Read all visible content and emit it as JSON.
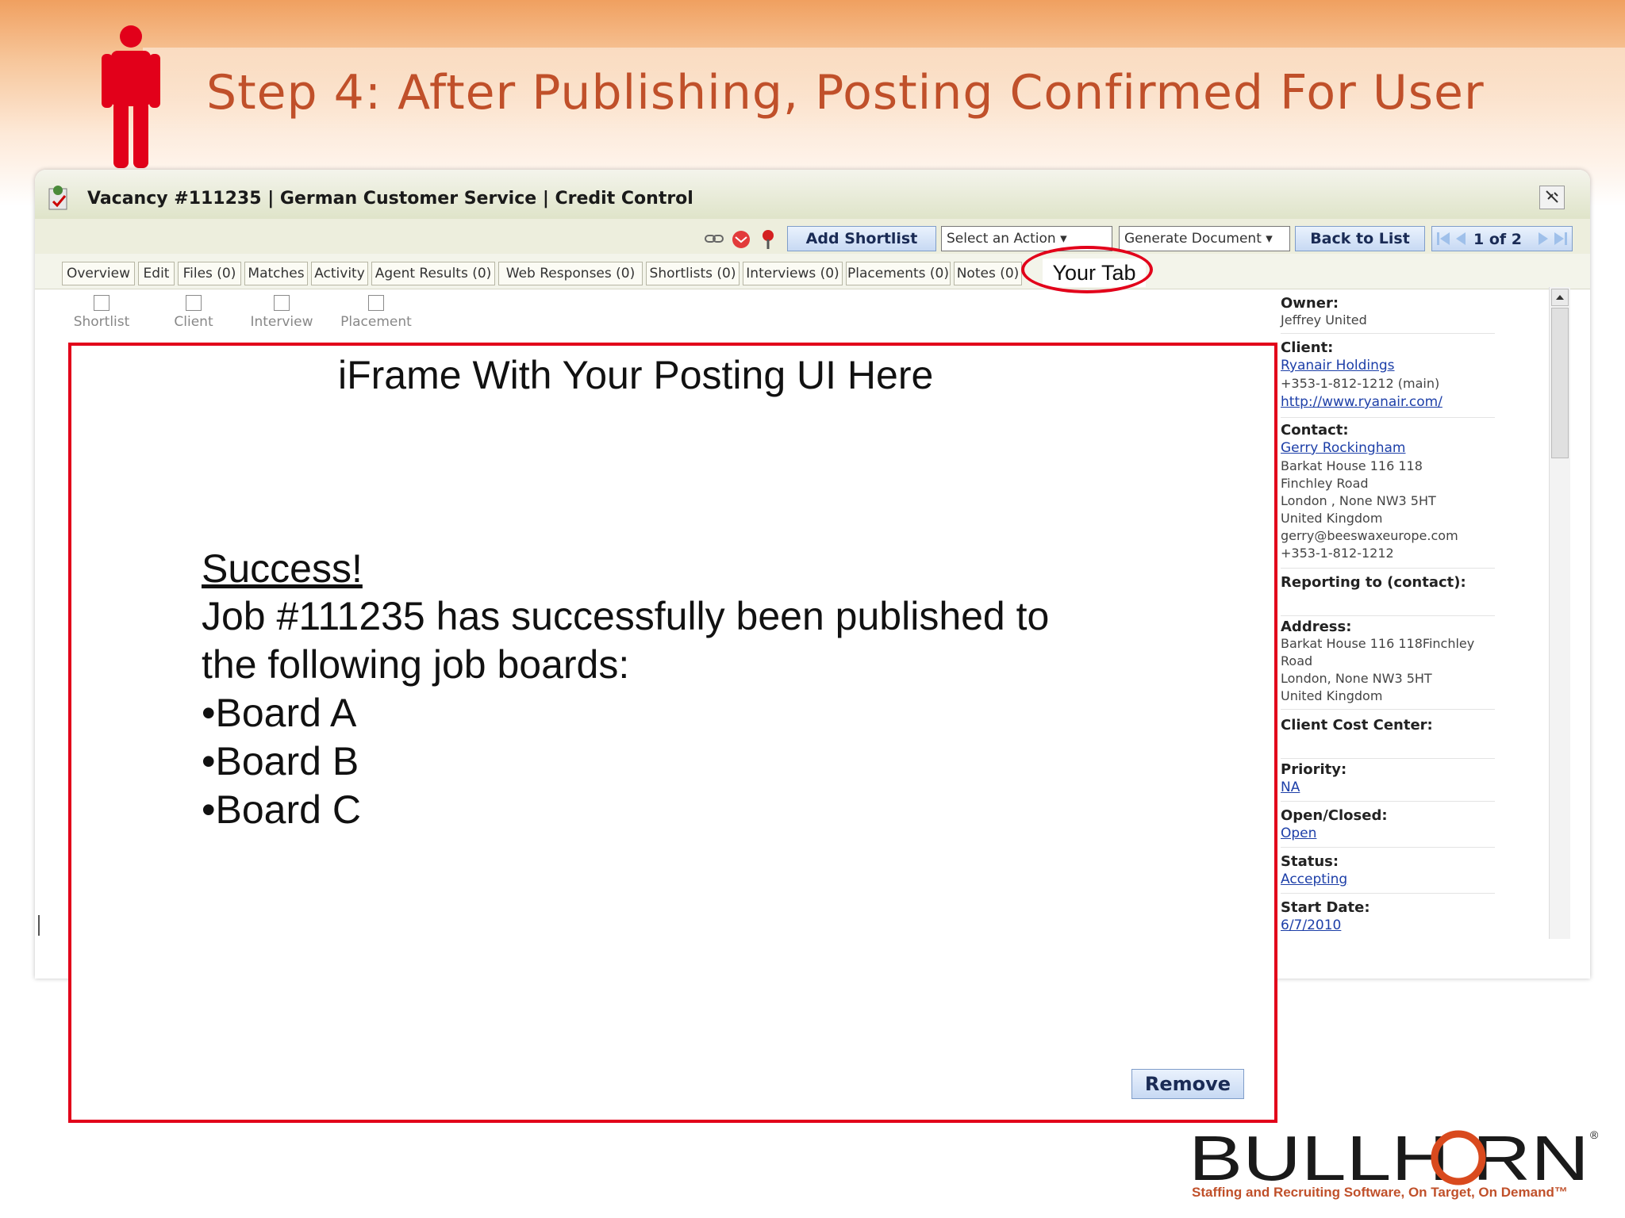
{
  "slide": {
    "title": "Step 4: After Publishing, Posting Confirmed For User"
  },
  "header": {
    "vacancy_title": "Vacancy #111235 | German Customer Service | Credit Control"
  },
  "toolbar": {
    "add_shortlist_label": "Add Shortlist",
    "select_action_label": "Select an Action ▾",
    "generate_document_label": "Generate Document ▾",
    "back_to_list_label": "Back to List",
    "pager_text": "1 of 2"
  },
  "tabs": [
    {
      "label": "Overview"
    },
    {
      "label": "Edit"
    },
    {
      "label": "Files (0)"
    },
    {
      "label": "Matches"
    },
    {
      "label": "Activity"
    },
    {
      "label": "Agent Results (0)"
    },
    {
      "label": "Web Responses (0)"
    },
    {
      "label": "Shortlists (0)"
    },
    {
      "label": "Interviews (0)"
    },
    {
      "label": "Placements (0)"
    },
    {
      "label": "Notes (0)"
    },
    {
      "label": "Your Tab"
    }
  ],
  "checkboxes": [
    {
      "label": "Shortlist"
    },
    {
      "label": "Client"
    },
    {
      "label": "Interview"
    },
    {
      "label": "Placement"
    }
  ],
  "iframe": {
    "title": "iFrame With Your Posting UI Here",
    "success_heading": "Success!",
    "message_line1": "Job #111235 has successfully been published to",
    "message_line2": "the following job boards:",
    "boards": [
      "•Board A",
      "•Board B",
      "•Board C"
    ],
    "remove_label": "Remove"
  },
  "sidebar": {
    "owner_label": "Owner:",
    "owner_value": "Jeffrey United",
    "client_label": "Client:",
    "client_name": "Ryanair Holdings",
    "client_phone": "+353-1-812-1212 (main)",
    "client_url": "http://www.ryanair.com/",
    "contact_label": "Contact:",
    "contact_name": "Gerry Rockingham",
    "contact_lines": [
      "Barkat House 116 118",
      "Finchley Road",
      "London , None NW3 5HT",
      "United Kingdom",
      "gerry@beeswaxeurope.com",
      "+353-1-812-1212"
    ],
    "reporting_label": "Reporting to (contact):",
    "address_label": "Address:",
    "address_lines": [
      "Barkat House 116 118Finchley",
      "Road",
      "London, None NW3 5HT",
      "United Kingdom"
    ],
    "cost_center_label": "Client Cost Center:",
    "priority_label": "Priority:",
    "priority_value": "NA",
    "open_closed_label": "Open/Closed:",
    "open_closed_value": "Open",
    "status_label": "Status:",
    "status_value": "Accepting",
    "start_date_label": "Start Date:",
    "start_date_value": "6/7/2010"
  },
  "branding": {
    "logo_text": "BULLHORN",
    "tagline": "Staffing and Recruiting Software, On Target, On Demand™"
  },
  "colors": {
    "title_orange": "#c0502a",
    "highlight_red": "#e2001a",
    "link_blue": "#1d3fa8"
  }
}
